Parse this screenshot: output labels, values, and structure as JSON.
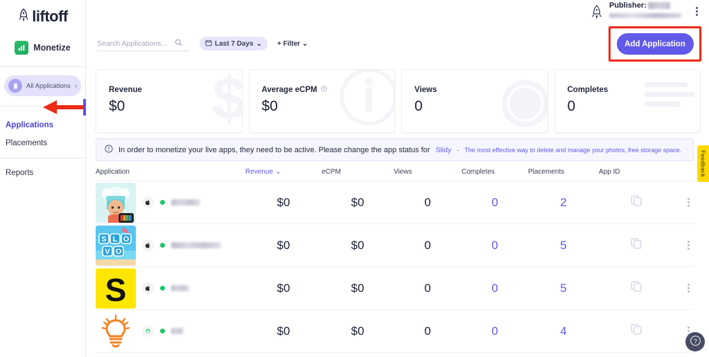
{
  "sidebar": {
    "logo_text": "liftoff",
    "logo_icon": "rocket-icon",
    "monetize_label": "Monetize",
    "monetize_icon": "bar-chart-icon",
    "all_applications": {
      "label": "All Applications",
      "icon": "mobile-phone-icon",
      "chevron": "›"
    },
    "nav_items": [
      {
        "label": "Applications",
        "active": true
      },
      {
        "label": "Placements",
        "active": false
      },
      {
        "label": "Reports",
        "active": false
      }
    ]
  },
  "header": {
    "publisher_label": "Publisher:",
    "publisher_value_redacted": true,
    "account_icon": "rocket-icon",
    "kebab_icon": "kebab-menu-icon",
    "add_application_label": "Add Application",
    "highlight_color": "#ec2a15",
    "accent_color": "#6159e8"
  },
  "toolbar": {
    "search_placeholder": "Search Applications...",
    "search_value": "",
    "search_icon": "search-icon",
    "date_range_label": "Last 7 Days",
    "calendar_icon": "calendar-icon",
    "date_chevron": "⌄",
    "filter_label": "+ Filter",
    "filter_chevron": "⌄"
  },
  "stat_cards": [
    {
      "label": "Revenue",
      "value": "$0",
      "watermark": "$",
      "has_info": false
    },
    {
      "label": "Average eCPM",
      "value": "$0",
      "watermark": "ⓘ",
      "has_info": true
    },
    {
      "label": "Views",
      "value": "0",
      "watermark": "◉",
      "has_info": false
    },
    {
      "label": "Completes",
      "value": "0",
      "watermark": "",
      "has_info": false
    }
  ],
  "banner": {
    "icon": "info-circle-icon",
    "text": "In order to monetize your live apps, they need to be active. Please change the app status for",
    "app_name": "Slidy",
    "separator": "-",
    "app_tagline": "The most effective way to delete and manage your photos, free storage space."
  },
  "table": {
    "columns": [
      {
        "key": "application",
        "label": "Application",
        "sorted": false
      },
      {
        "key": "revenue",
        "label": "Revenue",
        "sorted": true
      },
      {
        "key": "ecpm",
        "label": "eCPM",
        "sorted": false
      },
      {
        "key": "views",
        "label": "Views",
        "sorted": false
      },
      {
        "key": "completes",
        "label": "Completes",
        "sorted": false
      },
      {
        "key": "placements",
        "label": "Placements",
        "sorted": false
      },
      {
        "key": "app_id",
        "label": "App ID",
        "sorted": false
      }
    ],
    "sort_chevron": "⌄",
    "copy_icon": "copy-icon",
    "row_menu_icon": "kebab-menu-icon",
    "rows": [
      {
        "icon_kind": "toca-chef",
        "platform": "apple-icon",
        "status": "active",
        "name_redacted": true,
        "name_width": 42,
        "revenue": "$0",
        "ecpm": "$0",
        "views": "0",
        "completes": "0",
        "placements": "2"
      },
      {
        "icon_kind": "slovo",
        "platform": "apple-icon",
        "status": "active",
        "name_redacted": true,
        "name_width": 72,
        "revenue": "$0",
        "ecpm": "$0",
        "views": "0",
        "completes": "0",
        "placements": "5"
      },
      {
        "icon_kind": "yellow-s",
        "platform": "apple-icon",
        "status": "active",
        "name_redacted": true,
        "name_width": 26,
        "revenue": "$0",
        "ecpm": "$0",
        "views": "0",
        "completes": "0",
        "placements": "5"
      },
      {
        "icon_kind": "lightbulb",
        "platform": "android-icon",
        "status": "active",
        "name_redacted": true,
        "name_width": 18,
        "revenue": "$0",
        "ecpm": "$0",
        "views": "0",
        "completes": "0",
        "placements": "4"
      }
    ]
  },
  "right_rail": {
    "feedback_label": "Feedback",
    "feedback_color": "#ffd900",
    "help_icon": "question-circle-icon"
  },
  "annotation": {
    "arrow_color": "#ec2a15",
    "cursor_color": "#5b50e8",
    "target": "Applications"
  }
}
